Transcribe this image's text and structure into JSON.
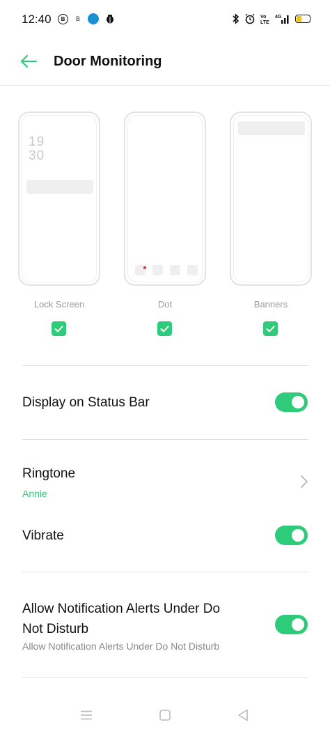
{
  "status_bar": {
    "time": "12:40",
    "left_icons": [
      "b-badge-icon",
      "b-small-icon",
      "blue-app-icon",
      "bug-icon"
    ],
    "right_icons": [
      "bluetooth-icon",
      "alarm-icon",
      "volte-icon",
      "signal-4g-icon",
      "battery-icon"
    ],
    "battery_color": "#f2c21b"
  },
  "header": {
    "title": "Door Monitoring",
    "back_icon": "back-arrow-icon",
    "accent_color": "#2ecc7a"
  },
  "previews": [
    {
      "label": "Lock Screen",
      "time_hour": "19",
      "time_min": "30",
      "checked": true
    },
    {
      "label": "Dot",
      "checked": true
    },
    {
      "label": "Banners",
      "checked": true
    }
  ],
  "settings": {
    "status_bar": {
      "label": "Display on Status Bar",
      "enabled": true
    },
    "ringtone": {
      "label": "Ringtone",
      "value": "Annie"
    },
    "vibrate": {
      "label": "Vibrate",
      "enabled": true
    },
    "dnd": {
      "label_line1": "Allow Notification Alerts Under Do",
      "label_line2": "Not Disturb",
      "description": "Allow Notification Alerts Under Do Not Disturb",
      "enabled": true
    }
  },
  "nav_bar": {
    "icons": [
      "menu-icon",
      "home-icon",
      "back-icon"
    ]
  }
}
